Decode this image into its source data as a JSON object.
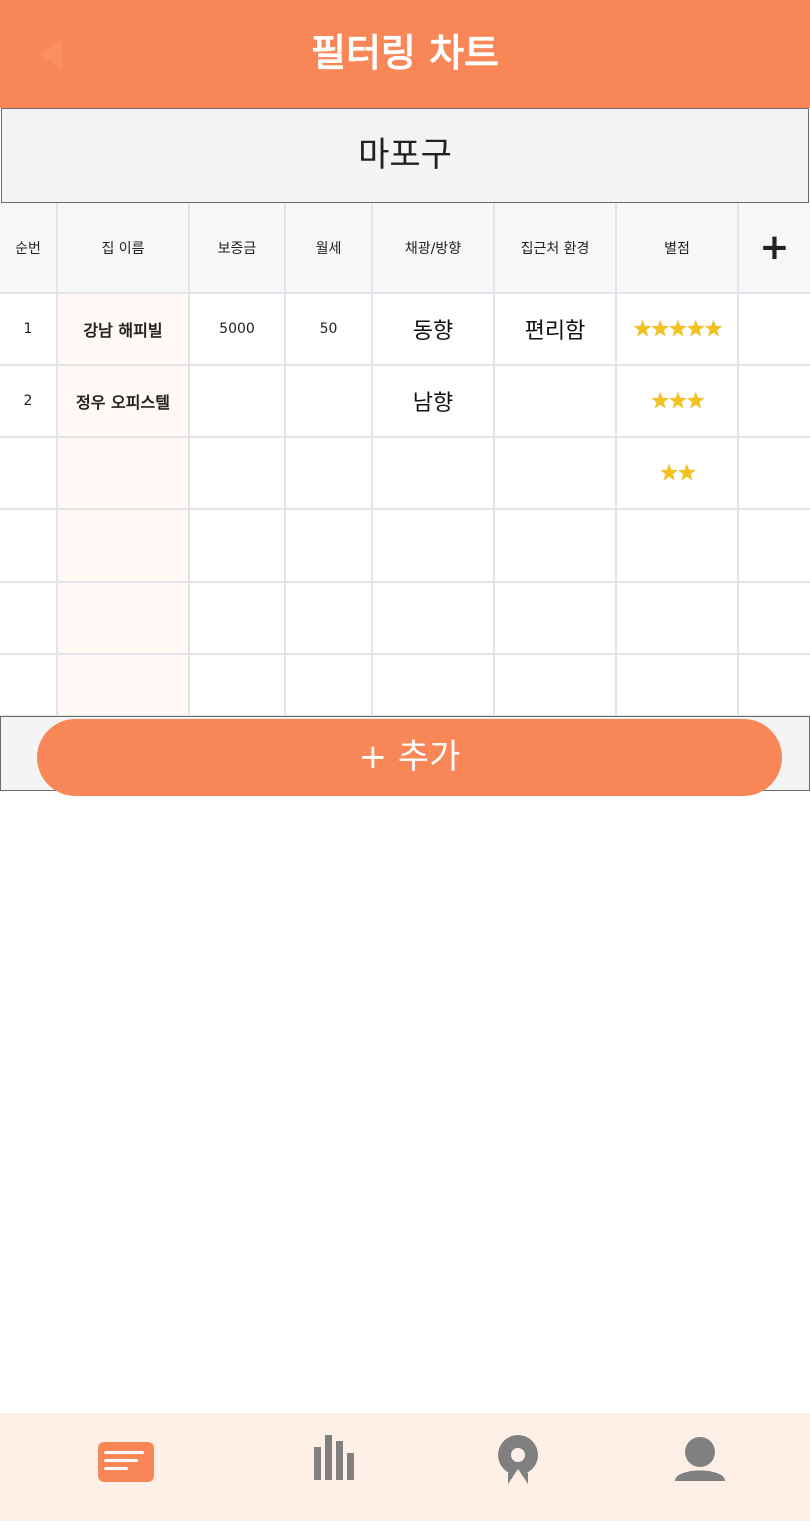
{
  "header": {
    "title": "필터링 차트",
    "back_icon": "back-arrow-icon",
    "accent": "#f98657"
  },
  "region": {
    "name": "마포구"
  },
  "table": {
    "columns": [
      "순번",
      "집 이름",
      "보증금",
      "월세",
      "채광/방향",
      "집근처 환경",
      "별점"
    ],
    "add_column_label": "+",
    "rows": [
      {
        "no": "1",
        "name": "강남 해피빌",
        "deposit": "5000",
        "rent": "50",
        "direction": "동향",
        "environment": "편리함",
        "rating": 5,
        "stars": "★★★★★"
      },
      {
        "no": "2",
        "name": "정우 오피스텔",
        "deposit": "",
        "rent": "",
        "direction": "남향",
        "environment": "",
        "rating": 3,
        "stars": "★★★"
      },
      {
        "no": "",
        "name": "",
        "deposit": "",
        "rent": "",
        "direction": "",
        "environment": "",
        "rating": 2,
        "stars": "★★"
      },
      {
        "no": "",
        "name": "",
        "deposit": "",
        "rent": "",
        "direction": "",
        "environment": "",
        "rating": 0,
        "stars": ""
      },
      {
        "no": "",
        "name": "",
        "deposit": "",
        "rent": "",
        "direction": "",
        "environment": "",
        "rating": 0,
        "stars": ""
      },
      {
        "no": "",
        "name": "",
        "deposit": "",
        "rent": "",
        "direction": "",
        "environment": "",
        "rating": 0,
        "stars": ""
      }
    ]
  },
  "add_button": {
    "label": "+ 추가"
  },
  "tabbar": {
    "tabs": [
      {
        "icon": "list-card-icon",
        "active": true
      },
      {
        "icon": "bar-chart-icon",
        "active": false
      },
      {
        "icon": "map-pin-icon",
        "active": false
      },
      {
        "icon": "user-icon",
        "active": false
      }
    ],
    "active_color": "#f98657",
    "inactive_color": "#808080"
  }
}
